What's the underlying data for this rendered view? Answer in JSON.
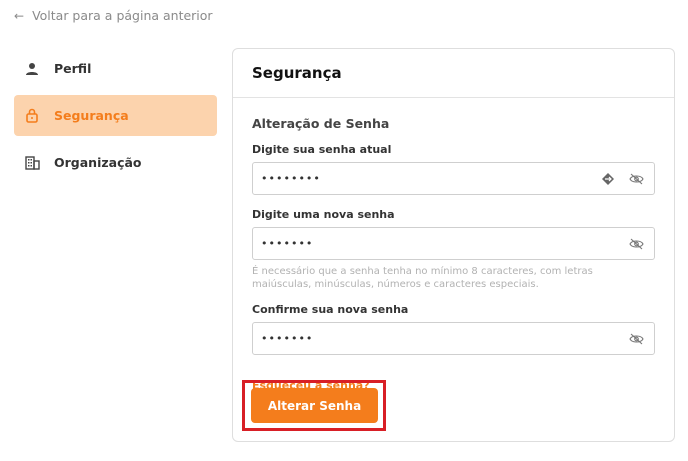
{
  "nav": {
    "back_label": "Voltar para a página anterior"
  },
  "sidebar": {
    "items": [
      {
        "label": "Perfil",
        "icon": "user-icon",
        "active": false
      },
      {
        "label": "Segurança",
        "icon": "lock-icon",
        "active": true
      },
      {
        "label": "Organização",
        "icon": "building-icon",
        "active": false
      }
    ]
  },
  "card": {
    "title": "Segurança",
    "section_title": "Alteração de Senha",
    "current_password": {
      "label": "Digite sua senha atual",
      "value": "••••••••"
    },
    "new_password": {
      "label": "Digite uma nova senha",
      "value": "•••••••",
      "hint": "É necessário que a senha tenha no mínimo 8 caracteres, com letras maiúsculas, minúsculas, números e caracteres especiais."
    },
    "confirm_password": {
      "label": "Confirme sua nova senha",
      "value": "•••••••"
    },
    "forgot_link": "Esqueceu a senha?",
    "submit_label": "Alterar Senha"
  },
  "colors": {
    "accent": "#f47d1c",
    "active_bg": "#fcd3ad",
    "highlight": "#d81f26"
  }
}
